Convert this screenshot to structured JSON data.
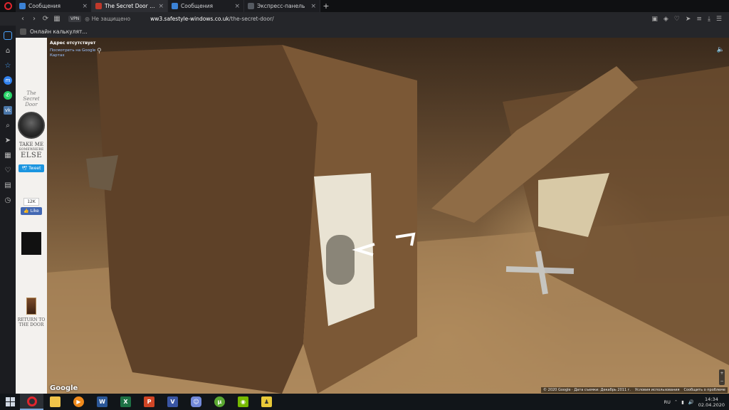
{
  "browser": {
    "tabs": [
      {
        "title": "Сообщения",
        "fav_color": "#3b82d6",
        "active": false
      },
      {
        "title": "The Secret Door - Step Th",
        "fav_color": "#c0392b",
        "active": true
      },
      {
        "title": "Сообщения",
        "fav_color": "#3b82d6",
        "active": false
      },
      {
        "title": "Экспресс-панель",
        "fav_color": "#555a61",
        "active": false
      }
    ],
    "vpn": "VPN",
    "security": "Не защищено",
    "url_host": "ww3.safestyle-windows.co.uk",
    "url_path": "/the-secret-door/",
    "bookmark": "Онлайн калькулят..."
  },
  "page": {
    "logo_text_1": "The",
    "logo_text_2": "Secret",
    "logo_text_3": "Door",
    "take_line1": "TAKE ME",
    "take_line2": "SOMEWHERE",
    "take_line3": "ELSE",
    "tweet": "Tweet",
    "like_count": "12K",
    "like": "Like",
    "return_line1": "RETURN TO",
    "return_line2": "THE DOOR"
  },
  "streetview": {
    "address_title": "Адрес отсутствует",
    "view_link": "Посмотреть на Google Картах",
    "google": "Google",
    "copyright": "© 2020 Google · Дата съемки: Декабрь 2011 г.",
    "terms": "Условия использования",
    "report": "Сообщить о проблеме"
  },
  "taskbar": {
    "lang": "RU",
    "time": "14:34",
    "date": "02.04.2020"
  }
}
